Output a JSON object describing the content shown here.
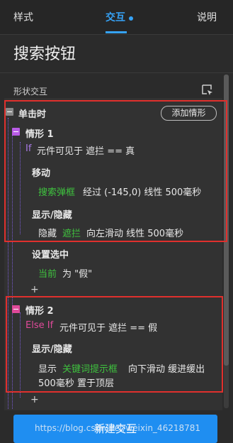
{
  "tabs": {
    "style": "样式",
    "interaction": "交互",
    "notes": "说明"
  },
  "title": "搜索按钮",
  "section": {
    "label": "形状交互"
  },
  "event": {
    "name": "单击时",
    "add_case": "添加情形"
  },
  "case1": {
    "name": "情形 1",
    "condition_kw": "If",
    "condition_text": "元件可见于 遮拦 == 真",
    "action_move_label": "移动",
    "move_target": "搜索弹框",
    "move_text": "经过 (-145,0) 线性 500毫秒",
    "action_show_label": "显示/隐藏",
    "hide_prefix": "隐藏",
    "hide_target": "遮拦",
    "hide_text": "向左滑动 线性 500毫秒",
    "action_select_label": "设置选中",
    "select_target": "当前",
    "select_text": "为 \"假\""
  },
  "case2": {
    "name": "情形 2",
    "condition_kw": "Else If",
    "condition_text": "元件可见于 遮拦 == 假",
    "action_show_label": "显示/隐藏",
    "show_prefix": "显示",
    "show_target": "关键词提示框",
    "show_text_line1": "向下滑动 缓进缓出",
    "show_text_line2": "500毫秒 置于顶层"
  },
  "plus": "+",
  "new_interaction": "新建交互",
  "watermark": "https://blog.csdn.net/weixin_46218781",
  "colors": {
    "accent": "#36a3f7",
    "highlight_box": "#e0302d",
    "target_green": "#3fc23f"
  }
}
